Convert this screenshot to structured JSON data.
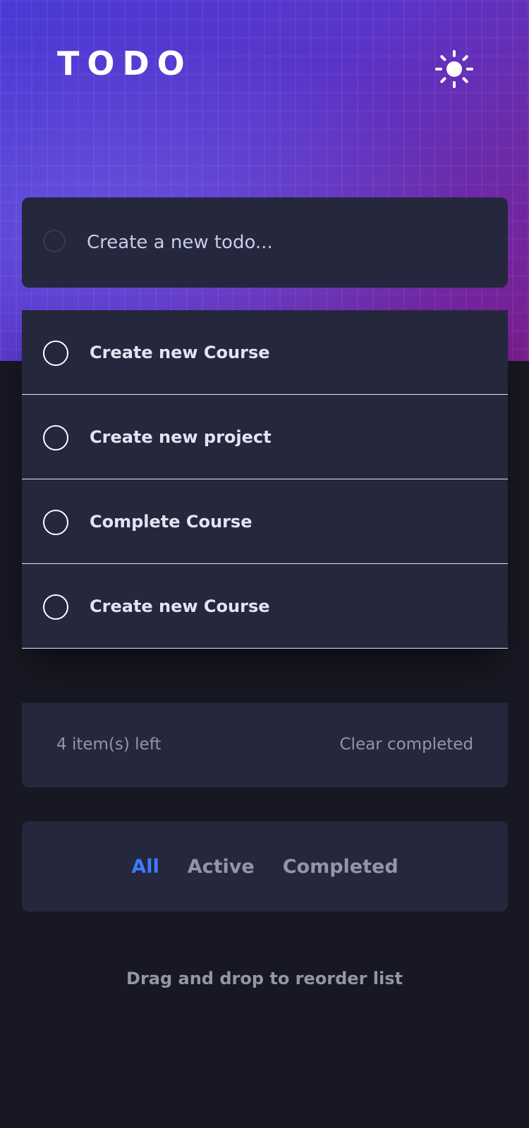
{
  "header": {
    "title": "TODO",
    "theme_icon": "sun-icon"
  },
  "new_todo": {
    "placeholder": "Create a new todo..."
  },
  "todos": [
    {
      "label": "Create new Course",
      "completed": false
    },
    {
      "label": "Create new project",
      "completed": false
    },
    {
      "label": "Complete Course",
      "completed": false
    },
    {
      "label": "Create new Course",
      "completed": false
    }
  ],
  "status": {
    "items_left": "4 item(s) left",
    "clear_completed": "Clear completed"
  },
  "filters": [
    {
      "label": "All",
      "active": true
    },
    {
      "label": "Active",
      "active": false
    },
    {
      "label": "Completed",
      "active": false
    }
  ],
  "hint": "Drag and drop to reorder list",
  "colors": {
    "background": "#171823",
    "card": "#25273d",
    "accent": "#3a7cfd",
    "muted_text": "#9495a5",
    "item_text": "#e3e4f1"
  }
}
